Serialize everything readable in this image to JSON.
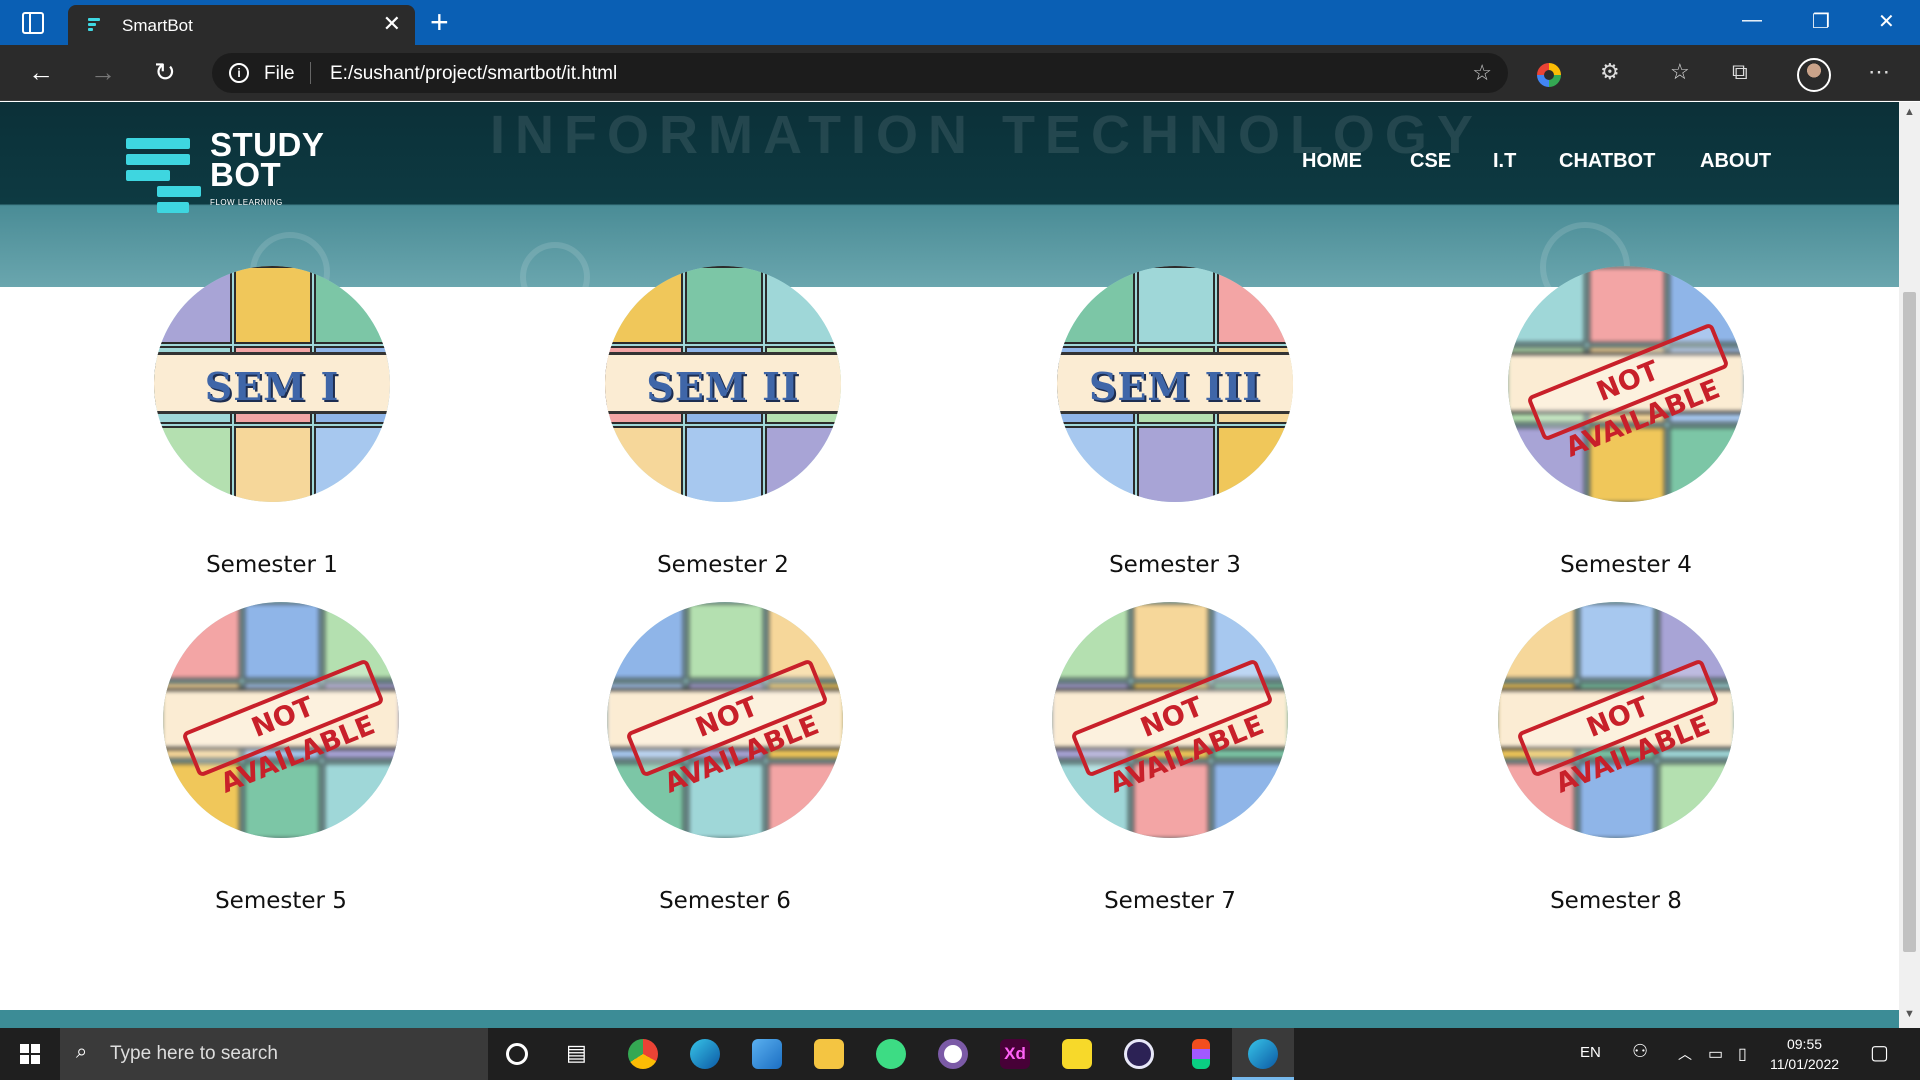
{
  "browser": {
    "tab_title": "SmartBot",
    "address_scheme": "File",
    "url": "E:/sushant/project/smartbot/it.html"
  },
  "site": {
    "logo_line1": "STUDY",
    "logo_line2": "BOT",
    "logo_tagline": "FLOW LEARNING",
    "hero_watermark": "INFORMATION TECHNOLOGY",
    "nav": [
      "HOME",
      "CSE",
      "I.T",
      "CHATBOT",
      "ABOUT"
    ],
    "accent_color": "#3ed6e0",
    "header_color": "#0c3038"
  },
  "semesters": [
    {
      "label": "Semester 1",
      "badge": "SEM I",
      "available": true
    },
    {
      "label": "Semester 2",
      "badge": "SEM II",
      "available": true
    },
    {
      "label": "Semester 3",
      "badge": "SEM III",
      "available": true
    },
    {
      "label": "Semester 4",
      "badge": "NOT AVAILABLE",
      "available": false
    },
    {
      "label": "Semester 5",
      "badge": "NOT AVAILABLE",
      "available": false
    },
    {
      "label": "Semester 6",
      "badge": "NOT AVAILABLE",
      "available": false
    },
    {
      "label": "Semester 7",
      "badge": "NOT AVAILABLE",
      "available": false
    },
    {
      "label": "Semester 8",
      "badge": "NOT AVAILABLE",
      "available": false
    }
  ],
  "taskbar": {
    "search_placeholder": "Type here to search",
    "language": "EN",
    "time": "09:55",
    "date": "11/01/2022"
  }
}
